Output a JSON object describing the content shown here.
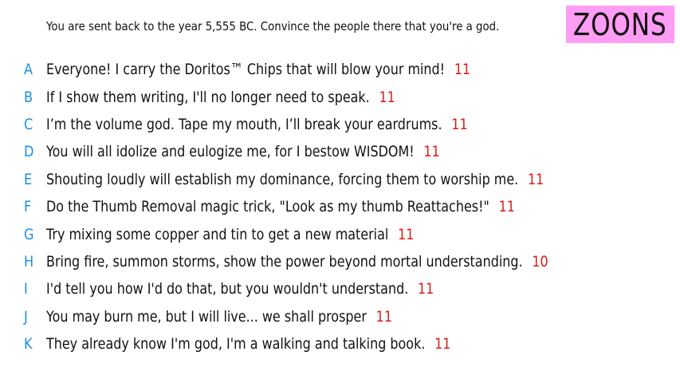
{
  "prompt": "You are sent back to the year 5,555 BC. Convince the people there that you're a god.",
  "logo": "ZOONS",
  "colors": {
    "letter": "#1a8fe3",
    "score": "#e01a1a",
    "logo_bg": "#ff9cf4"
  },
  "answers": [
    {
      "letter": "A",
      "text": "Everyone! I carry the Doritos™ Chips that will blow your mind!",
      "score": "11"
    },
    {
      "letter": "B",
      "text": "If I show them writing, I'll no longer need to speak.",
      "score": "11"
    },
    {
      "letter": "C",
      "text": "I’m the volume god. Tape my mouth, I’ll break your eardrums.",
      "score": "11"
    },
    {
      "letter": "D",
      "text": "You will all idolize and eulogize me, for I bestow WISDOM!",
      "score": "11"
    },
    {
      "letter": "E",
      "text": "Shouting loudly will establish my dominance, forcing them to worship me.",
      "score": "11"
    },
    {
      "letter": "F",
      "text": "Do the Thumb Removal magic trick, \"Look as my thumb Reattaches!\"",
      "score": "11"
    },
    {
      "letter": "G",
      "text": "Try mixing some copper and tin to get a new material",
      "score": "11"
    },
    {
      "letter": "H",
      "text": "Bring fire, summon storms, show the power beyond mortal understanding.",
      "score": "10"
    },
    {
      "letter": "I",
      "text": "I'd tell you how I'd do that, but you wouldn't understand.",
      "score": "11"
    },
    {
      "letter": "J",
      "text": "You may burn me, but I will live... we shall prosper",
      "score": "11"
    },
    {
      "letter": "K",
      "text": "They already know I'm god, I'm a walking and talking book.",
      "score": "11"
    }
  ]
}
